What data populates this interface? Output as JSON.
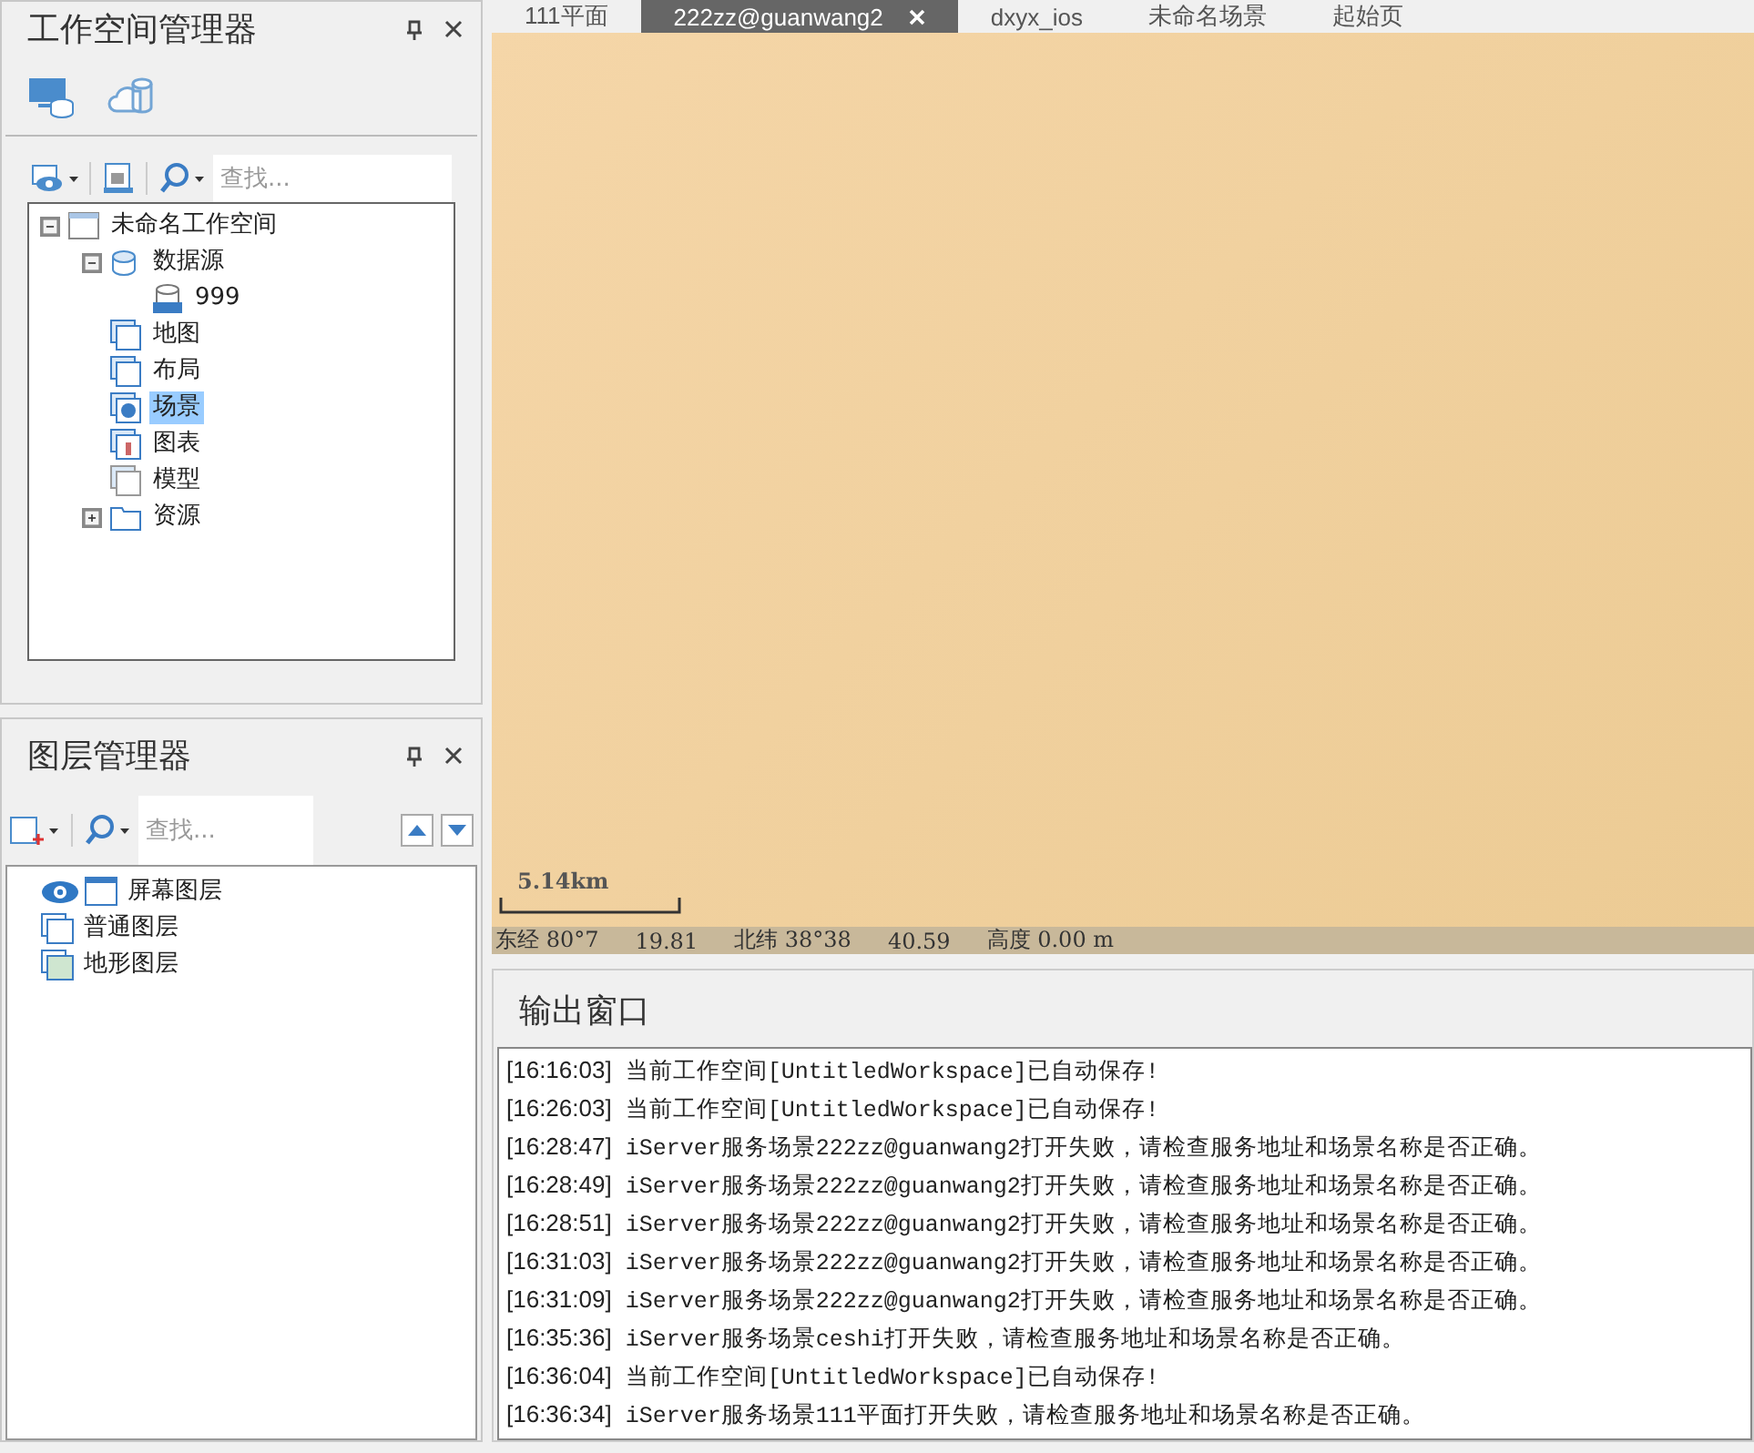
{
  "workspace_panel": {
    "title": "工作空间管理器",
    "view_tabs": [
      {
        "kind": "local",
        "selected": true
      },
      {
        "kind": "cloud",
        "selected": false
      }
    ],
    "search": {
      "placeholder": "查找..."
    },
    "tree": [
      {
        "label": "未命名工作空间",
        "kind": "workspace",
        "expanded": true,
        "selected": false,
        "children": [
          {
            "label": "数据源",
            "kind": "datasources",
            "expanded": true,
            "selected": false,
            "children": [
              {
                "label": "999",
                "kind": "udx",
                "selected": false
              }
            ]
          },
          {
            "label": "地图",
            "kind": "map",
            "selected": false
          },
          {
            "label": "布局",
            "kind": "layout",
            "selected": false
          },
          {
            "label": "场景",
            "kind": "scene",
            "selected": true
          },
          {
            "label": "图表",
            "kind": "chart",
            "selected": false
          },
          {
            "label": "模型",
            "kind": "model",
            "selected": false
          },
          {
            "label": "资源",
            "kind": "resources",
            "expanded": false,
            "selected": false
          }
        ]
      }
    ]
  },
  "layer_panel": {
    "title": "图层管理器",
    "search": {
      "placeholder": "查找..."
    },
    "layers": [
      {
        "label": "屏幕图层",
        "kind": "screen",
        "visible": true
      },
      {
        "label": "普通图层",
        "kind": "normal",
        "visible": false
      },
      {
        "label": "地形图层",
        "kind": "terrain",
        "visible": false
      }
    ]
  },
  "tabs": [
    {
      "label": "111平面",
      "selected": false
    },
    {
      "label": "222zz@guanwang2",
      "selected": true
    },
    {
      "label": "dxyx_ios",
      "selected": false
    },
    {
      "label": "未命名场景",
      "selected": false
    },
    {
      "label": "起始页",
      "selected": false
    }
  ],
  "scene": {
    "scale": "5.14km",
    "status": [
      "东经 80°7",
      "19.81",
      "北纬 38°38",
      "40.59",
      "高度 0.00 m"
    ]
  },
  "output": {
    "title": "输出窗口",
    "lines": [
      {
        "time": "[16:16:03]",
        "message": "当前工作空间[UntitledWorkspace]已自动保存!"
      },
      {
        "time": "[16:26:03]",
        "message": "当前工作空间[UntitledWorkspace]已自动保存!"
      },
      {
        "time": "[16:28:47]",
        "message": "iServer服务场景222zz@guanwang2打开失败，请检查服务地址和场景名称是否正确。"
      },
      {
        "time": "[16:28:49]",
        "message": "iServer服务场景222zz@guanwang2打开失败，请检查服务地址和场景名称是否正确。"
      },
      {
        "time": "[16:28:51]",
        "message": "iServer服务场景222zz@guanwang2打开失败，请检查服务地址和场景名称是否正确。"
      },
      {
        "time": "[16:31:03]",
        "message": "iServer服务场景222zz@guanwang2打开失败，请检查服务地址和场景名称是否正确。"
      },
      {
        "time": "[16:31:09]",
        "message": "iServer服务场景222zz@guanwang2打开失败，请检查服务地址和场景名称是否正确。"
      },
      {
        "time": "[16:35:36]",
        "message": "iServer服务场景ceshi打开失败，请检查服务地址和场景名称是否正确。"
      },
      {
        "time": "[16:36:04]",
        "message": "当前工作空间[UntitledWorkspace]已自动保存!"
      },
      {
        "time": "[16:36:34]",
        "message": "iServer服务场景111平面打开失败，请检查服务地址和场景名称是否正确。"
      }
    ]
  }
}
